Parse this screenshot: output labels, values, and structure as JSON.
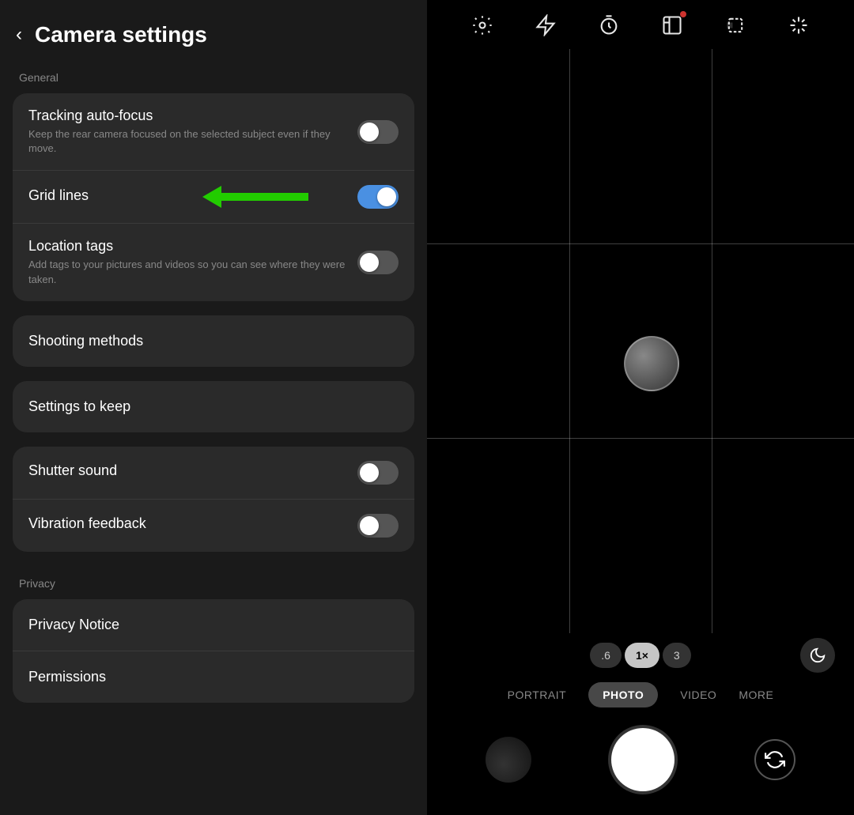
{
  "header": {
    "back_label": "‹",
    "title": "Camera settings"
  },
  "sections": {
    "general_label": "General",
    "privacy_label": "Privacy"
  },
  "settings": {
    "tracking_autofocus": {
      "title": "Tracking auto-focus",
      "subtitle": "Keep the rear camera focused on the selected subject even if they move.",
      "toggle_state": "on-dark"
    },
    "grid_lines": {
      "title": "Grid lines",
      "toggle_state": "on"
    },
    "location_tags": {
      "title": "Location tags",
      "subtitle": "Add tags to your pictures and videos so you can see where they were taken.",
      "toggle_state": "on-dark"
    },
    "shooting_methods": {
      "title": "Shooting methods"
    },
    "settings_to_keep": {
      "title": "Settings to keep"
    },
    "shutter_sound": {
      "title": "Shutter sound",
      "toggle_state": "off"
    },
    "vibration_feedback": {
      "title": "Vibration feedback",
      "toggle_state": "off"
    },
    "privacy_notice": {
      "title": "Privacy Notice"
    },
    "permissions": {
      "title": "Permissions"
    }
  },
  "camera": {
    "zoom_options": [
      ".6",
      "1×",
      "3"
    ],
    "active_zoom": "1×",
    "modes": [
      "PORTRAIT",
      "PHOTO",
      "VIDEO",
      "MORE"
    ],
    "active_mode": "PHOTO"
  },
  "icons": {
    "settings": "⚙",
    "flash": "⚡",
    "timer": "◷",
    "ratio": "1:1",
    "crop": "▱",
    "sparkle": "✦",
    "moon": "☽",
    "flip": "↺"
  }
}
